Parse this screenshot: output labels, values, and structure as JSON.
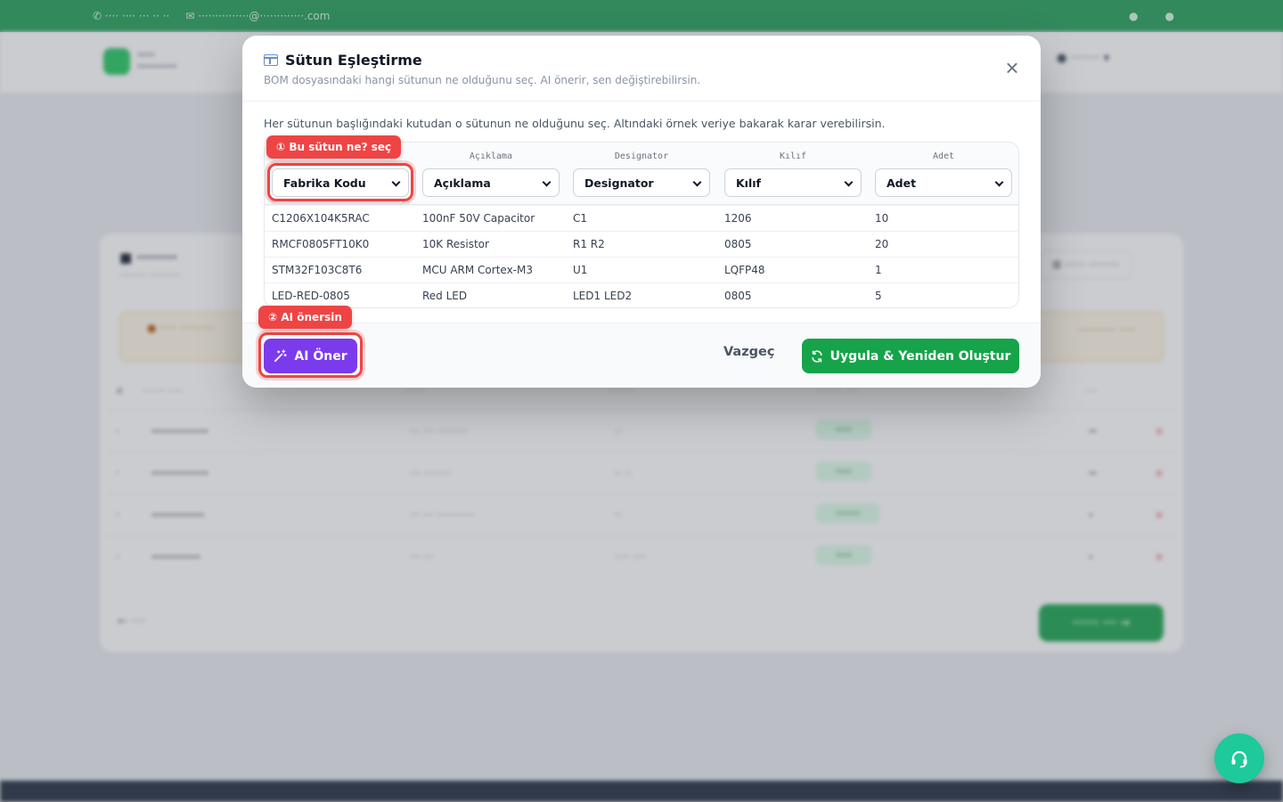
{
  "modal": {
    "title": "Sütun Eşleştirme",
    "subtitle": "BOM dosyasındaki hangi sütunun ne olduğunu seç. AI önerir, sen değiştirebilirsin.",
    "instruction": "Her sütunun başlığındaki kutudan o sütunun ne olduğunu seç. Altındaki örnek veriye bakarak karar verebilirsin.",
    "close_icon": "close-icon",
    "columns": [
      {
        "header": "",
        "selected": "Fabrika Kodu"
      },
      {
        "header": "Açıklama",
        "selected": "Açıklama"
      },
      {
        "header": "Designator",
        "selected": "Designator"
      },
      {
        "header": "Kılıf",
        "selected": "Kılıf"
      },
      {
        "header": "Adet",
        "selected": "Adet"
      }
    ],
    "rows": [
      [
        "C1206X104K5RAC",
        "100nF 50V Capacitor",
        "C1",
        "1206",
        "10"
      ],
      [
        "RMCF0805FT10K0",
        "10K Resistor",
        "R1 R2",
        "0805",
        "20"
      ],
      [
        "STM32F103C8T6",
        "MCU ARM Cortex-M3",
        "U1",
        "LQFP48",
        "1"
      ],
      [
        "LED-RED-0805",
        "Red LED",
        "LED1 LED2",
        "0805",
        "5"
      ]
    ],
    "callout_1": "① Bu sütun ne? seç",
    "callout_2": "② AI önersin",
    "ai_button": "AI Öner",
    "cancel_button": "Vazgeç",
    "apply_button": "Uygula & Yeniden Oluştur"
  },
  "colors": {
    "accent_green": "#16a34a",
    "accent_purple": "#7c3aed",
    "highlight_red": "#ef4444",
    "support_teal": "#1ec99a"
  },
  "icons": {
    "table": "table-columns-icon",
    "magic": "magic-wand-icon",
    "refresh": "refresh-icon",
    "support": "headset-icon"
  }
}
